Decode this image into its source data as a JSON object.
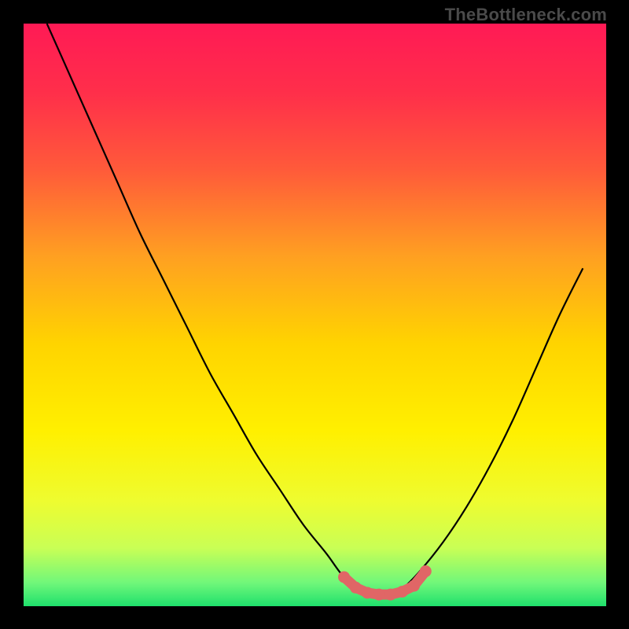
{
  "watermark": "TheBottleneck.com",
  "gradient_stops": [
    {
      "offset": 0.0,
      "color": "#ff1a55"
    },
    {
      "offset": 0.12,
      "color": "#ff2f4a"
    },
    {
      "offset": 0.25,
      "color": "#ff5a3a"
    },
    {
      "offset": 0.4,
      "color": "#ffa021"
    },
    {
      "offset": 0.55,
      "color": "#ffd400"
    },
    {
      "offset": 0.7,
      "color": "#fff000"
    },
    {
      "offset": 0.82,
      "color": "#eefc30"
    },
    {
      "offset": 0.9,
      "color": "#c9ff55"
    },
    {
      "offset": 0.96,
      "color": "#70f77a"
    },
    {
      "offset": 1.0,
      "color": "#1fe06c"
    }
  ],
  "curve_color": "#000000",
  "marker_color": "#e06666",
  "chart_data": {
    "type": "line",
    "title": "",
    "xlabel": "",
    "ylabel": "",
    "xlim": [
      0,
      100
    ],
    "ylim": [
      0,
      100
    ],
    "series": [
      {
        "name": "bottleneck_curve",
        "x": [
          4,
          8,
          12,
          16,
          20,
          24,
          28,
          32,
          36,
          40,
          44,
          48,
          52,
          55,
          58,
          61,
          63,
          65,
          68,
          72,
          76,
          80,
          84,
          88,
          92,
          96
        ],
        "y": [
          100,
          91,
          82,
          73,
          64,
          56,
          48,
          40,
          33,
          26,
          20,
          14,
          9,
          5,
          3,
          2,
          2,
          3,
          6,
          11,
          17,
          24,
          32,
          41,
          50,
          58
        ]
      }
    ],
    "markers": {
      "name": "highlight",
      "x": [
        55,
        57,
        59,
        61,
        63,
        65,
        67,
        69
      ],
      "y": [
        5,
        3.2,
        2.3,
        2,
        2,
        2.5,
        3.5,
        6
      ]
    }
  }
}
